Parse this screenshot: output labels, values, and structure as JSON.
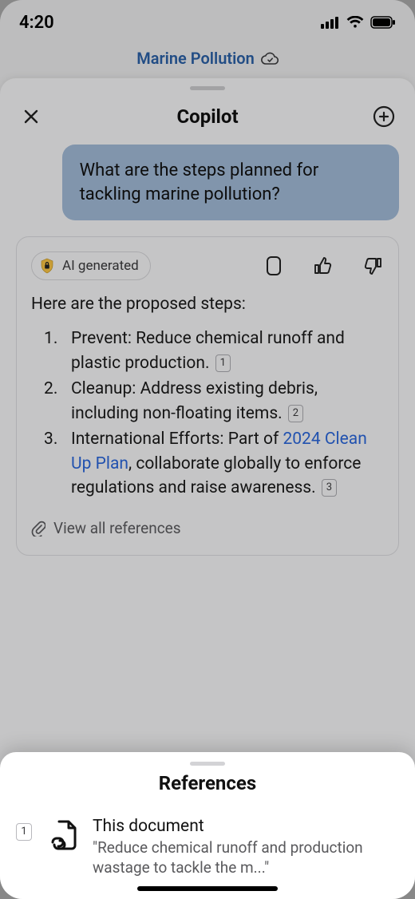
{
  "statusbar": {
    "time": "4:20"
  },
  "doc": {
    "title": "Marine Pollution"
  },
  "copilot": {
    "title": "Copilot",
    "user_message": "What are the steps planned for tackling marine pollution?",
    "ai_chip_label": "AI generated",
    "intro": "Here are the proposed steps:",
    "steps": [
      {
        "prefix": "Prevent: Reduce chemical runoff and plastic production. ",
        "cite": "1"
      },
      {
        "prefix": "Cleanup: Address existing debris, including non-floating items. ",
        "cite": "2"
      },
      {
        "prefix": "International Efforts: Part of ",
        "link": "2024 Clean Up Plan",
        "suffix": ", collaborate globally to enforce regulations and raise awareness. ",
        "cite": "3"
      }
    ],
    "view_refs_label": "View all references"
  },
  "references": {
    "title": "References",
    "items": [
      {
        "num": "1",
        "title": "This document",
        "snippet": "\"Reduce chemical runoff and production wastage to tackle the m...\""
      }
    ]
  }
}
